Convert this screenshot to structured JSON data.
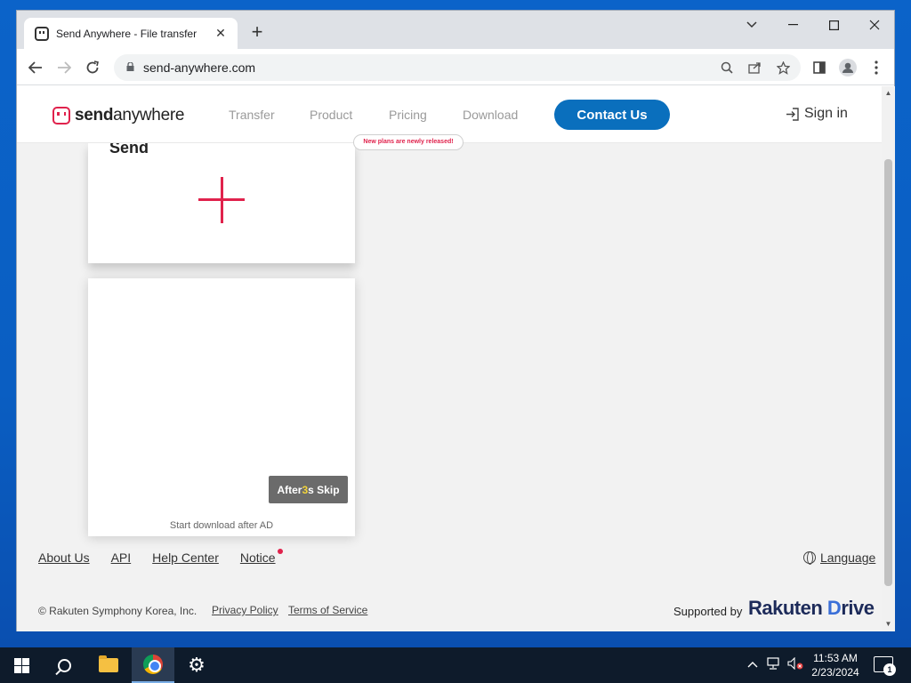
{
  "browser": {
    "tab_title": "Send Anywhere - File transfer",
    "url": "send-anywhere.com",
    "tab_close": "✕",
    "new_tab": "+"
  },
  "site": {
    "logo_bold": "send",
    "logo_light": "anywhere",
    "nav": [
      "Transfer",
      "Product",
      "Pricing",
      "Download"
    ],
    "pricing_badge": "New plans are newly released!",
    "contact_label": "Contact Us",
    "signin_label": "Sign in",
    "send_title": "Send",
    "skip_prefix": "After",
    "skip_count": "3",
    "skip_suffix": "s Skip",
    "ad_note": "Start download after AD",
    "brand_color": "#e0224c",
    "contact_color": "#0a6fbd"
  },
  "footer": {
    "links": [
      "About Us",
      "API",
      "Help Center",
      "Notice"
    ],
    "language_label": "Language",
    "copyright": "© Rakuten Symphony Korea, Inc.",
    "privacy": "Privacy Policy",
    "terms": "Terms of Service",
    "supported_by": "Supported by",
    "rakuten_main": "Rakuten",
    "rakuten_drive_d": "D",
    "rakuten_drive_rest": "rive"
  },
  "taskbar": {
    "time": "11:53 AM",
    "date": "2/23/2024",
    "notification_count": "1",
    "pinned": [
      "start-icon",
      "search-icon",
      "file-explorer-icon",
      "chrome-icon",
      "settings-icon"
    ]
  }
}
